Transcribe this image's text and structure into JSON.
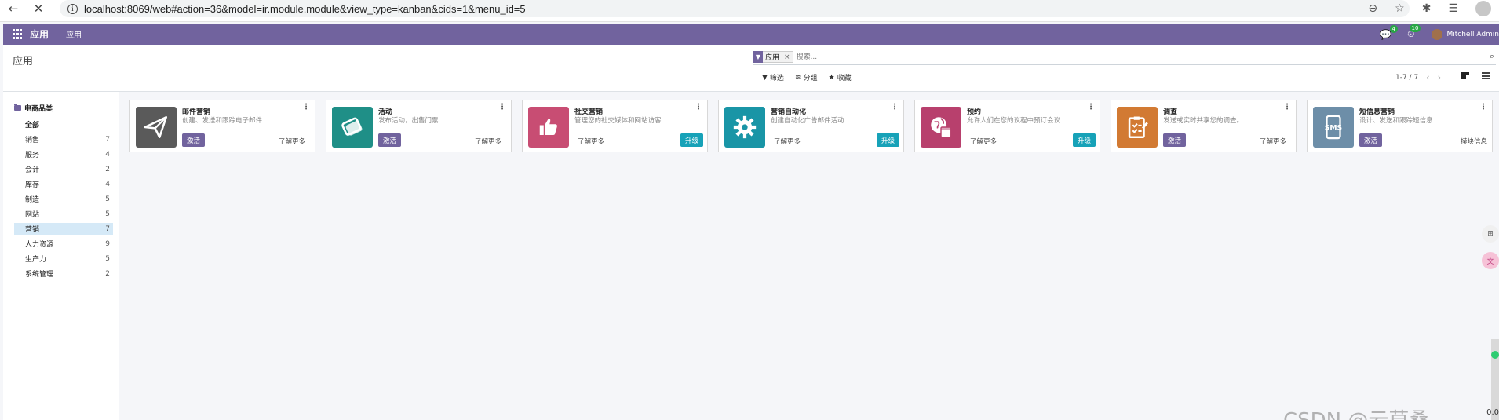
{
  "browser": {
    "url": "localhost:8069/web#action=36&model=ir.module.module&view_type=kanban&cids=1&menu_id=5"
  },
  "topbar": {
    "brand": "应用",
    "menu_item": "应用",
    "messages_badge": "4",
    "activities_badge": "10",
    "user_name": "Mitchell Admin"
  },
  "control_panel": {
    "title": "应用",
    "facet_value": "应用",
    "search_placeholder": "搜索...",
    "filter_label": "筛选",
    "group_label": "分组",
    "favorite_label": "收藏",
    "pager": "1-7 / 7"
  },
  "sidebar": {
    "heading": "电商品类",
    "items": [
      {
        "label": "全部",
        "count": ""
      },
      {
        "label": "销售",
        "count": "7"
      },
      {
        "label": "服务",
        "count": "4"
      },
      {
        "label": "会计",
        "count": "2"
      },
      {
        "label": "库存",
        "count": "4"
      },
      {
        "label": "制造",
        "count": "5"
      },
      {
        "label": "网站",
        "count": "5"
      },
      {
        "label": "营销",
        "count": "7"
      },
      {
        "label": "人力资源",
        "count": "9"
      },
      {
        "label": "生产力",
        "count": "5"
      },
      {
        "label": "系统管理",
        "count": "2"
      }
    ],
    "active_item": "营销"
  },
  "cards": [
    {
      "name": "邮件营销",
      "desc": "创建、发送和跟踪电子邮件",
      "primary": "激活",
      "more": "了解更多",
      "upgrade": "",
      "icon": "paper-plane-icon",
      "color": "#5a5a5a"
    },
    {
      "name": "活动",
      "desc": "发布活动，出售门票",
      "primary": "激活",
      "more": "了解更多",
      "upgrade": "",
      "icon": "ticket-icon",
      "color": "#1f8f87"
    },
    {
      "name": "社交营销",
      "desc": "管理您的社交媒体和网站访客",
      "primary": "",
      "more": "了解更多",
      "upgrade": "升级",
      "icon": "thumbs-up-icon",
      "color": "#c84d73"
    },
    {
      "name": "营销自动化",
      "desc": "创建自动化广告邮件活动",
      "primary": "",
      "more": "了解更多",
      "upgrade": "升级",
      "icon": "gear-icon",
      "color": "#1995a6"
    },
    {
      "name": "预约",
      "desc": "允许人们在您的议程中预订会议",
      "primary": "",
      "more": "了解更多",
      "upgrade": "升级",
      "icon": "calendar-globe-icon",
      "color": "#b8406d"
    },
    {
      "name": "调查",
      "desc": "发送或实时共享您的调查。",
      "primary": "激活",
      "more": "了解更多",
      "upgrade": "",
      "icon": "clipboard-icon",
      "color": "#d27a33"
    },
    {
      "name": "短信息营销",
      "desc": "设计、发送和跟踪短信息",
      "primary": "激活",
      "more": "",
      "upgrade": "",
      "right_text": "模块信息",
      "icon": "sms-icon",
      "color": "#6d8ea8"
    }
  ],
  "watermark": "CSDN @云草桑",
  "scroll_label": "0.0"
}
